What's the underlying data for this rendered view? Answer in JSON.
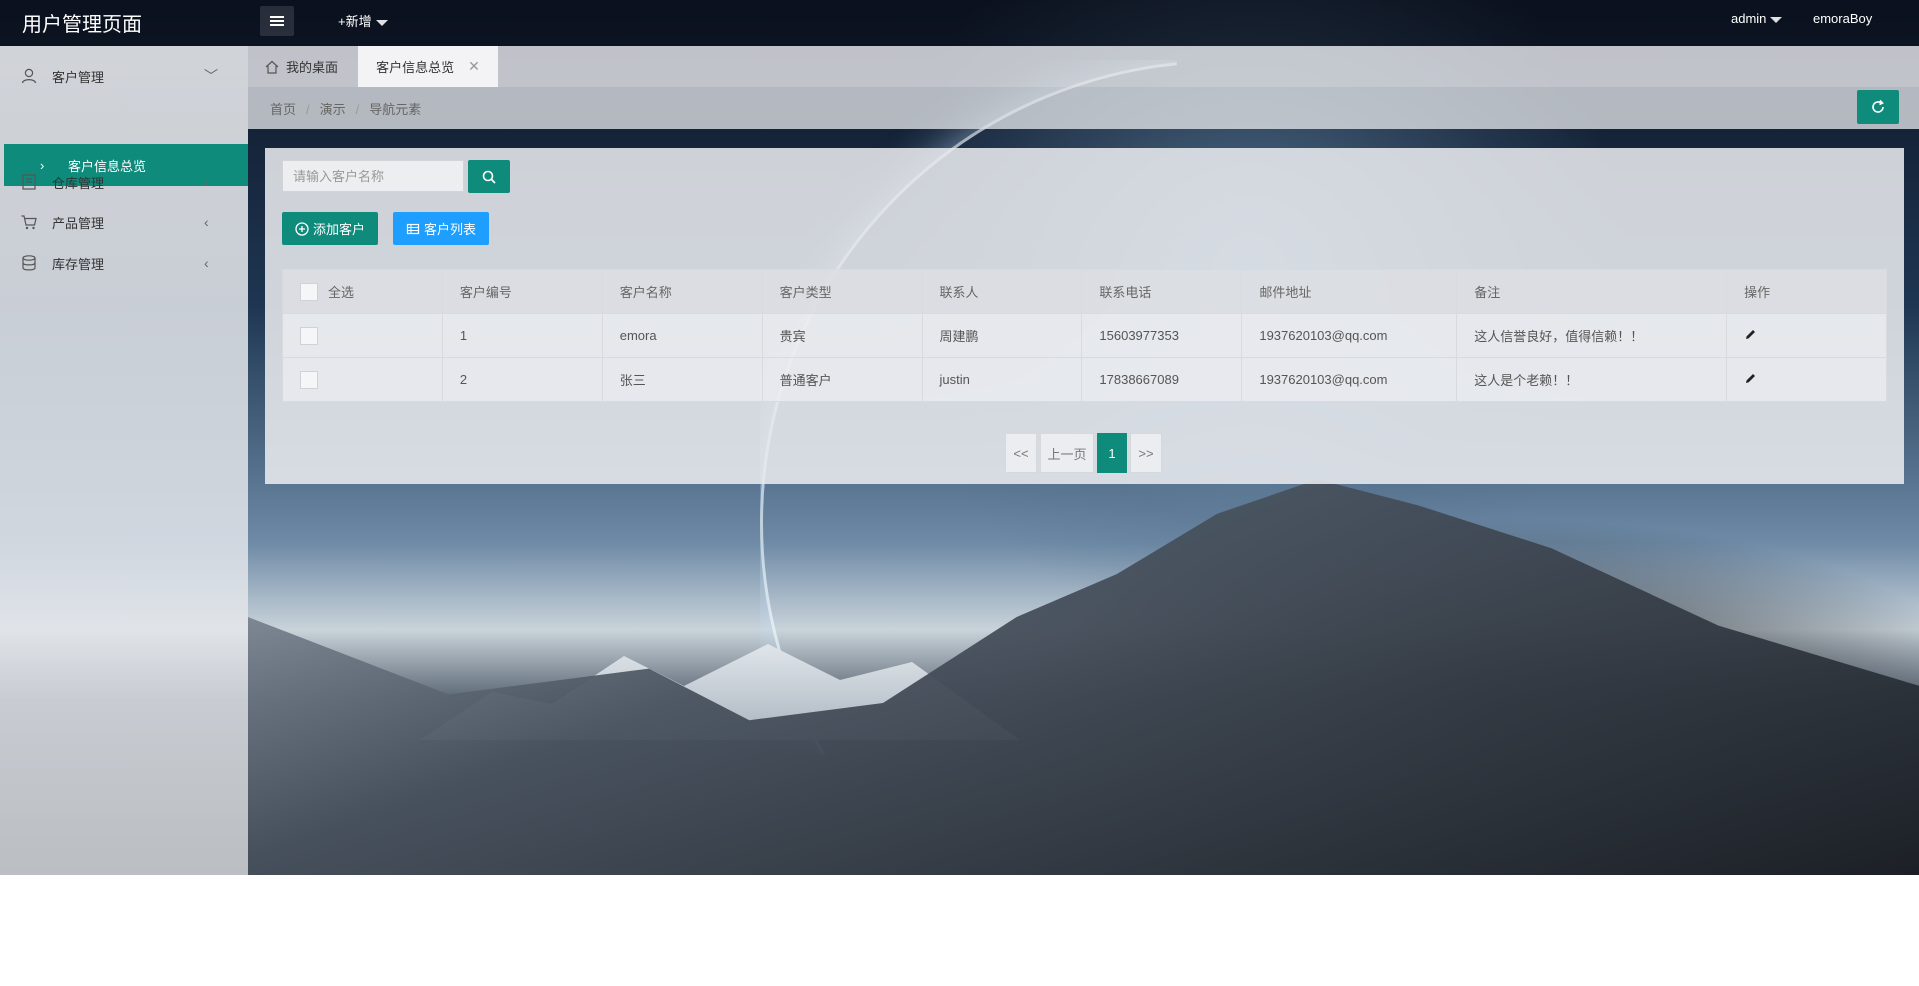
{
  "header": {
    "brand": "用户管理页面",
    "new_label": "+新增",
    "user": "admin",
    "nickname": "emoraBoy"
  },
  "sidebar": {
    "items": [
      {
        "label": "客户管理",
        "icon": "user-icon"
      },
      {
        "label": "客户信息总览",
        "icon": "chevron-right-icon"
      },
      {
        "label": "仓库管理",
        "icon": "warehouse-icon"
      },
      {
        "label": "产品管理",
        "icon": "cart-icon"
      },
      {
        "label": "库存管理",
        "icon": "database-icon"
      }
    ]
  },
  "tabs": {
    "home": "我的桌面",
    "active": "客户信息总览"
  },
  "breadcrumb": [
    "首页",
    "演示",
    "导航元素"
  ],
  "search": {
    "placeholder": "请输入客户名称"
  },
  "toolbar": {
    "add_label": "添加客户",
    "list_label": "客户列表"
  },
  "table": {
    "select_all": "全选",
    "columns": [
      "客户编号",
      "客户名称",
      "客户类型",
      "联系人",
      "联系电话",
      "邮件地址",
      "备注",
      "操作"
    ],
    "rows": [
      [
        "1",
        "emora",
        "贵宾",
        "周建鹏",
        "15603977353",
        "1937620103@qq.com",
        "这人信誉良好，值得信赖！！"
      ],
      [
        "2",
        "张三",
        "普通客户",
        "justin",
        "17838667089",
        "1937620103@qq.com",
        "这人是个老赖！！"
      ]
    ]
  },
  "pagination": {
    "first": "<<",
    "prev": "上一页",
    "current": "1",
    "last": ">>"
  },
  "colors": {
    "accent": "#0f8b7c",
    "blue": "#1e9fff"
  }
}
